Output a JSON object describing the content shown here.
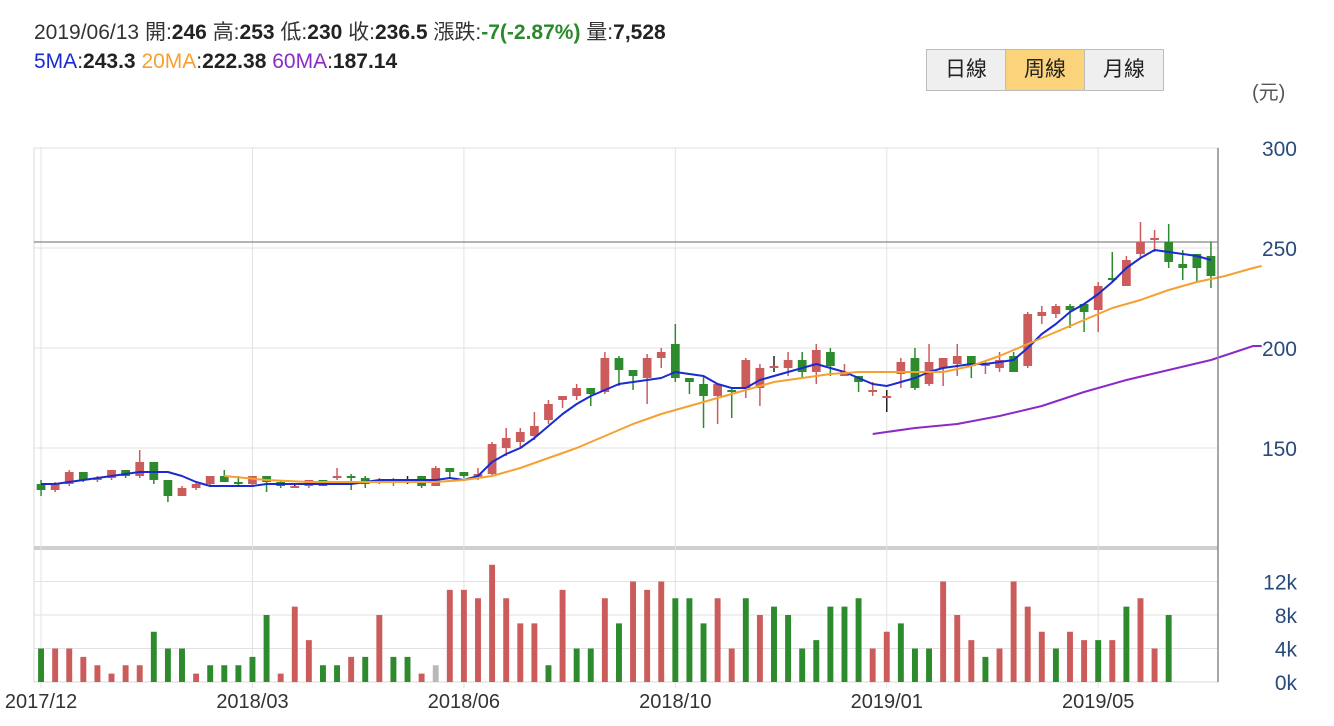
{
  "header": {
    "date": "2019/06/13",
    "open_label": "開:",
    "open": "246",
    "high_label": "高:",
    "high": "253",
    "low_label": "低:",
    "low": "230",
    "close_label": "收:",
    "close": "236.5",
    "change_label": "漲跌:",
    "change": "-7(-2.87%)",
    "volume_label": "量:",
    "volume": "7,528",
    "ma5_label": "5MA",
    "ma5": "243.3",
    "ma20_label": "20MA",
    "ma20": "222.38",
    "ma60_label": "60MA",
    "ma60": "187.14"
  },
  "tabs": [
    {
      "label": "日線",
      "active": false
    },
    {
      "label": "周線",
      "active": true
    },
    {
      "label": "月線",
      "active": false
    }
  ],
  "unit": "(元)",
  "colors": {
    "up": "#cc5c5c",
    "down": "#2d8a2d",
    "flat": "#b8b8b8",
    "ma5": "#1a2bd0",
    "ma20": "#f5a132",
    "ma60": "#8a2bc8"
  },
  "chart_data": {
    "type": "candlestick",
    "price_axis": {
      "ticks": [
        "300",
        "250",
        "200",
        "150"
      ],
      "range": [
        100,
        300
      ],
      "reference_line": 253
    },
    "volume_axis": {
      "ticks": [
        "12k",
        "8k",
        "4k",
        "0k"
      ],
      "range": [
        0,
        16
      ]
    },
    "date_ticks": [
      {
        "label": "2017/12",
        "index": 0
      },
      {
        "label": "2018/03",
        "index": 15
      },
      {
        "label": "2018/06",
        "index": 30
      },
      {
        "label": "2018/10",
        "index": 45
      },
      {
        "label": "2019/01",
        "index": 60
      },
      {
        "label": "2019/05",
        "index": 75
      }
    ],
    "candles": [
      [
        132,
        129,
        134,
        126
      ],
      [
        129,
        132,
        133,
        128
      ],
      [
        132,
        138,
        139,
        131
      ],
      [
        138,
        134,
        138,
        133
      ],
      [
        134,
        135,
        136,
        133
      ],
      [
        135,
        139,
        139,
        134
      ],
      [
        139,
        136,
        139,
        135
      ],
      [
        136,
        143,
        149,
        135
      ],
      [
        143,
        134,
        143,
        132
      ],
      [
        134,
        126,
        134,
        123
      ],
      [
        126,
        130,
        131,
        126
      ],
      [
        130,
        132,
        133,
        129
      ],
      [
        132,
        136,
        136,
        131
      ],
      [
        136,
        133,
        139,
        133
      ],
      [
        133,
        132,
        136,
        131
      ],
      [
        132,
        136,
        136,
        131
      ],
      [
        136,
        133,
        136,
        128
      ],
      [
        133,
        131,
        134,
        130
      ],
      [
        131,
        131,
        132,
        130
      ],
      [
        131,
        134,
        134,
        130
      ],
      [
        134,
        131,
        134,
        131
      ],
      [
        135,
        136,
        140,
        134
      ],
      [
        136,
        135,
        137,
        129
      ],
      [
        135,
        132,
        136,
        130
      ],
      [
        133,
        134,
        135,
        132
      ],
      [
        133,
        134,
        135,
        131
      ],
      [
        134,
        134,
        136,
        132
      ],
      [
        136,
        131,
        136,
        130
      ],
      [
        131,
        140,
        141,
        131
      ],
      [
        140,
        138,
        140,
        135
      ],
      [
        138,
        136,
        138,
        135
      ],
      [
        135,
        137,
        140,
        134
      ],
      [
        137,
        152,
        153,
        136
      ],
      [
        150,
        155,
        160,
        146
      ],
      [
        153,
        158,
        160,
        150
      ],
      [
        156,
        161,
        168,
        154
      ],
      [
        164,
        172,
        174,
        162
      ],
      [
        174,
        176,
        176,
        170
      ],
      [
        176,
        180,
        182,
        174
      ],
      [
        180,
        177,
        180,
        171
      ],
      [
        178,
        195,
        198,
        177
      ],
      [
        195,
        189,
        196,
        181
      ],
      [
        189,
        186,
        189,
        179
      ],
      [
        185,
        195,
        197,
        172
      ],
      [
        195,
        198,
        200,
        190
      ],
      [
        202,
        185,
        212,
        183
      ],
      [
        185,
        183,
        185,
        177
      ],
      [
        182,
        176,
        186,
        160
      ],
      [
        176,
        182,
        182,
        162
      ],
      [
        179,
        178,
        180,
        165
      ],
      [
        180,
        194,
        195,
        175
      ],
      [
        180,
        190,
        192,
        171
      ],
      [
        191,
        191,
        196,
        188
      ],
      [
        190,
        194,
        198,
        186
      ],
      [
        194,
        188,
        198,
        185
      ],
      [
        188,
        199,
        202,
        182
      ],
      [
        198,
        191,
        200,
        186
      ],
      [
        186,
        188,
        192,
        186
      ],
      [
        186,
        183,
        186,
        178
      ],
      [
        178,
        179,
        183,
        176
      ],
      [
        176,
        176,
        179,
        168
      ],
      [
        187,
        193,
        195,
        180
      ],
      [
        195,
        180,
        200,
        179
      ],
      [
        182,
        193,
        202,
        181
      ],
      [
        190,
        195,
        194,
        181
      ],
      [
        192,
        196,
        202,
        186
      ],
      [
        196,
        191,
        196,
        185
      ],
      [
        191,
        192,
        194,
        187
      ],
      [
        190,
        194,
        198,
        188
      ],
      [
        196,
        188,
        198,
        188
      ],
      [
        191,
        217,
        218,
        190
      ],
      [
        216,
        218,
        221,
        212
      ],
      [
        217,
        221,
        222,
        215
      ],
      [
        221,
        219,
        222,
        210
      ],
      [
        222,
        218,
        222,
        208
      ],
      [
        219,
        231,
        233,
        208
      ],
      [
        235,
        234,
        248,
        233
      ],
      [
        231,
        244,
        246,
        232
      ],
      [
        247,
        253,
        263,
        245
      ],
      [
        254,
        255,
        259,
        248
      ],
      [
        253,
        243,
        262,
        240
      ],
      [
        242,
        240,
        249,
        234
      ],
      [
        247,
        240,
        247,
        233
      ],
      [
        246,
        236,
        253,
        230
      ]
    ],
    "volumes": [
      4,
      4,
      4,
      3,
      2,
      1,
      2,
      2,
      6,
      4,
      4,
      1,
      2,
      2,
      2,
      3,
      8,
      1,
      9,
      5,
      2,
      2,
      3,
      3,
      8,
      3,
      3,
      1,
      2,
      11,
      11,
      10,
      14,
      10,
      7,
      7,
      2,
      11,
      4,
      4,
      10,
      7,
      12,
      11,
      12,
      10,
      10,
      7,
      10,
      4,
      10,
      8,
      9,
      8,
      4,
      5,
      9,
      9,
      10,
      4,
      6,
      7,
      4,
      4,
      12,
      8,
      5,
      3,
      4,
      12,
      9,
      6,
      4,
      6,
      5,
      5,
      5,
      9,
      10,
      4,
      8
    ],
    "volume_up": [
      false,
      true,
      true,
      true,
      true,
      true,
      true,
      true,
      false,
      false,
      false,
      true,
      false,
      false,
      false,
      false,
      false,
      true,
      true,
      true,
      false,
      false,
      true,
      false,
      true,
      false,
      false,
      true,
      true,
      true,
      true,
      true,
      true,
      true,
      true,
      true,
      false,
      true,
      false,
      false,
      true,
      false,
      true,
      true,
      true,
      false,
      false,
      false,
      true,
      true,
      false,
      true,
      false,
      false,
      false,
      false,
      false,
      false,
      false,
      true,
      true,
      false,
      false,
      false,
      true,
      true,
      true,
      false,
      true,
      true,
      true,
      true,
      false,
      true,
      true,
      false,
      true,
      false,
      true,
      true,
      false
    ],
    "ma5": [
      132,
      132,
      133,
      134,
      135,
      136,
      137,
      138,
      138,
      138,
      136,
      133,
      131,
      131,
      131,
      131,
      132,
      132,
      132,
      132,
      132,
      132,
      132,
      133,
      134,
      134,
      134,
      134,
      134,
      135,
      134,
      136,
      143,
      147,
      150,
      155,
      161,
      167,
      172,
      176,
      179,
      182,
      183,
      184,
      185,
      188,
      187,
      186,
      182,
      180,
      180,
      184,
      186,
      188,
      190,
      192,
      190,
      188,
      185,
      182,
      181,
      183,
      185,
      188,
      190,
      191,
      192,
      192,
      193,
      194,
      200,
      207,
      212,
      218,
      222,
      227,
      233,
      240,
      245,
      249,
      248,
      247,
      246,
      244
    ],
    "ma20": [
      [
        13,
        136
      ],
      [
        16,
        134
      ],
      [
        19,
        133
      ],
      [
        22,
        133
      ],
      [
        25,
        133
      ],
      [
        28,
        133
      ],
      [
        30,
        134
      ],
      [
        32,
        136
      ],
      [
        34,
        140
      ],
      [
        36,
        145
      ],
      [
        38,
        150
      ],
      [
        40,
        156
      ],
      [
        42,
        162
      ],
      [
        44,
        167
      ],
      [
        46,
        171
      ],
      [
        48,
        175
      ],
      [
        50,
        179
      ],
      [
        52,
        183
      ],
      [
        54,
        185
      ],
      [
        56,
        187
      ],
      [
        58,
        188
      ],
      [
        60,
        188
      ],
      [
        62,
        188
      ],
      [
        64,
        188
      ],
      [
        66,
        191
      ],
      [
        68,
        196
      ],
      [
        70,
        202
      ],
      [
        72,
        208
      ],
      [
        74,
        214
      ],
      [
        76,
        220
      ],
      [
        78,
        224
      ],
      [
        80,
        229
      ],
      [
        82,
        233
      ],
      [
        84,
        236
      ],
      [
        85,
        238
      ],
      [
        86,
        240
      ],
      [
        86.6,
        241
      ]
    ],
    "ma60": [
      [
        59,
        157
      ],
      [
        62,
        160
      ],
      [
        65,
        162
      ],
      [
        68,
        166
      ],
      [
        71,
        171
      ],
      [
        74,
        178
      ],
      [
        77,
        184
      ],
      [
        80,
        189
      ],
      [
        83,
        194
      ],
      [
        86,
        201
      ],
      [
        86.6,
        201
      ]
    ]
  }
}
